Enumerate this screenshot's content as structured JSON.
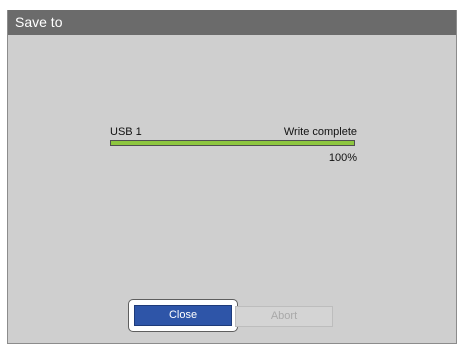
{
  "dialog": {
    "title": "Save to"
  },
  "transfer": {
    "device": "USB 1",
    "status": "Write complete",
    "progress_fraction": 1.0,
    "progress_label": "100%",
    "progress_color": "#8dc63f"
  },
  "buttons": {
    "close_label": "Close",
    "abort_label": "Abort",
    "close_enabled": true,
    "abort_enabled": false
  }
}
